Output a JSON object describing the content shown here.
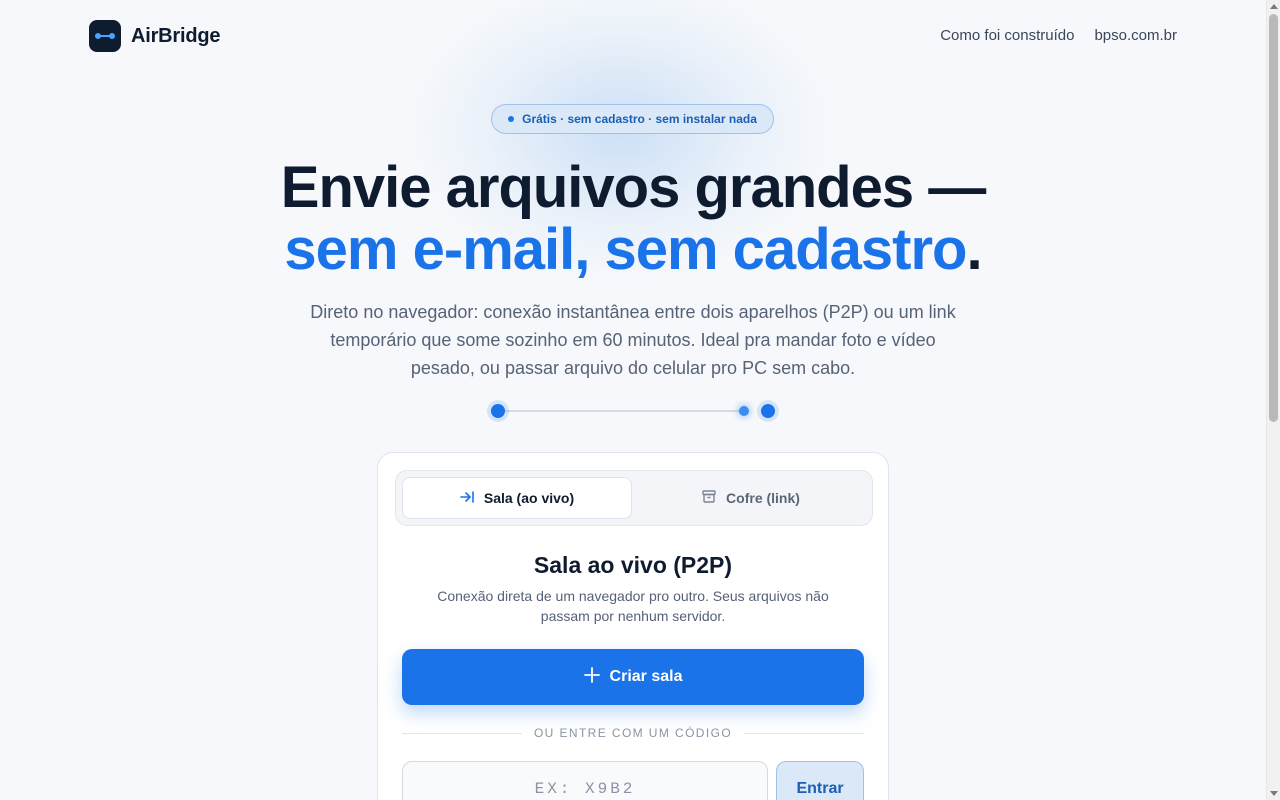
{
  "header": {
    "brand": "AirBridge",
    "nav": [
      {
        "label": "Como foi construído"
      },
      {
        "label": "bpso.com.br"
      }
    ]
  },
  "hero": {
    "badge": "Grátis · sem cadastro · sem instalar nada",
    "title_line1": "Envie arquivos grandes —",
    "title_line2": "sem e-mail, sem cadastro",
    "title_period": ".",
    "lead": "Direto no navegador: conexão instantânea entre dois aparelhos (P2P) ou um link temporário que some sozinho em 60 minutos. Ideal pra mandar foto e vídeo pesado, ou passar arquivo do celular pro PC sem cabo."
  },
  "card": {
    "tabs": [
      {
        "label": "Sala (ao vivo)",
        "icon": "arrow-right-to-line-icon",
        "active": true
      },
      {
        "label": "Cofre (link)",
        "icon": "archive-icon",
        "active": false
      }
    ],
    "title": "Sala ao vivo (P2P)",
    "description": "Conexão direta de um navegador pro outro. Seus arquivos não passam por nenhum servidor.",
    "create_button": "Criar sala",
    "divider": "OU ENTRE COM UM CÓDIGO",
    "code_placeholder": "EX: X9B2",
    "enter_button": "Entrar"
  },
  "colors": {
    "accent": "#1a73e8",
    "ink": "#0f1b2e",
    "muted": "#566276",
    "badge_bg": "#dbe8f8"
  }
}
